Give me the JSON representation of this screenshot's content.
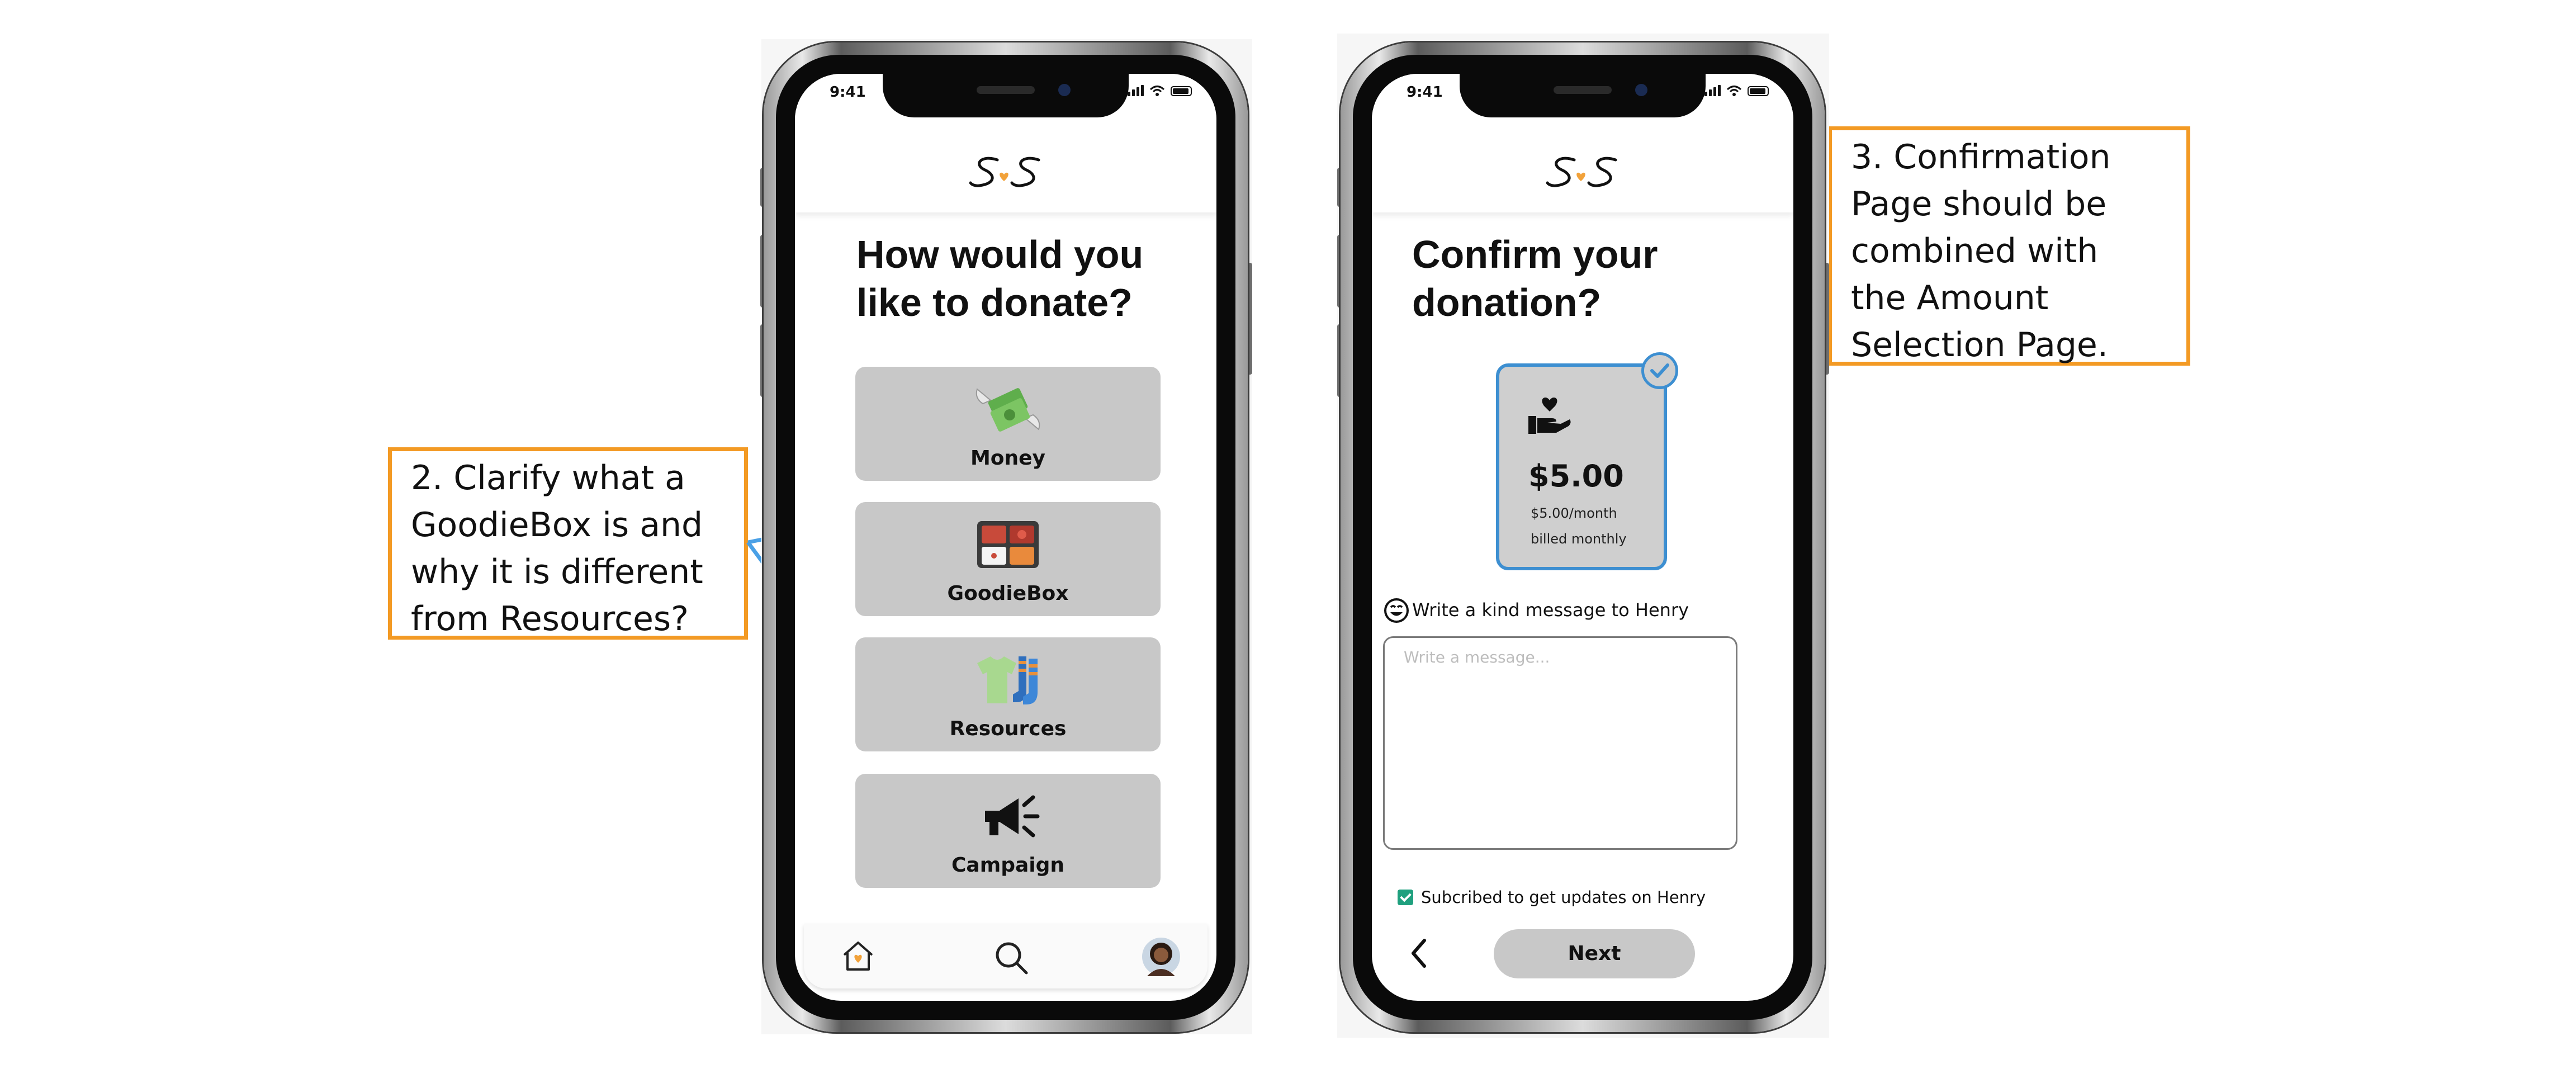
{
  "annotations": {
    "left_note": {
      "lines": [
        "2. Clarify what a",
        "GoodieBox is and",
        "why it is different",
        "from Resources?"
      ]
    },
    "right_note": {
      "lines": [
        "3. Confirmation",
        "Page should be",
        "combined with",
        "the Amount",
        "Selection Page."
      ]
    }
  },
  "colors": {
    "annotation_border": "#f39a24",
    "arrow": "#4aa0e6",
    "selection": "#3d8fd1",
    "option_bg": "#c8c8c8",
    "logo_heart": "#f2a23a"
  },
  "phone_left": {
    "status_time": "9:41",
    "heading": [
      "How would you",
      "like to donate?"
    ],
    "options": [
      {
        "label": "Money",
        "icon": "money-wings-icon"
      },
      {
        "label": "GoodieBox",
        "icon": "bento-box-icon"
      },
      {
        "label": "Resources",
        "icon": "tshirt-socks-icon"
      },
      {
        "label": "Campaign",
        "icon": "megaphone-icon"
      }
    ],
    "tabbar": [
      "home-icon",
      "search-icon",
      "profile-avatar"
    ]
  },
  "phone_right": {
    "status_time": "9:41",
    "heading": [
      "Confirm your",
      "donation?"
    ],
    "plan": {
      "price": "$5.00",
      "period": "$5.00/month",
      "billing": "billed monthly"
    },
    "message_prompt": "Write a kind message to Henry",
    "message_placeholder": "Write a message...",
    "subscribe_label": "Subcribed to get updates on Henry",
    "subscribe_checked": true,
    "next_label": "Next"
  }
}
